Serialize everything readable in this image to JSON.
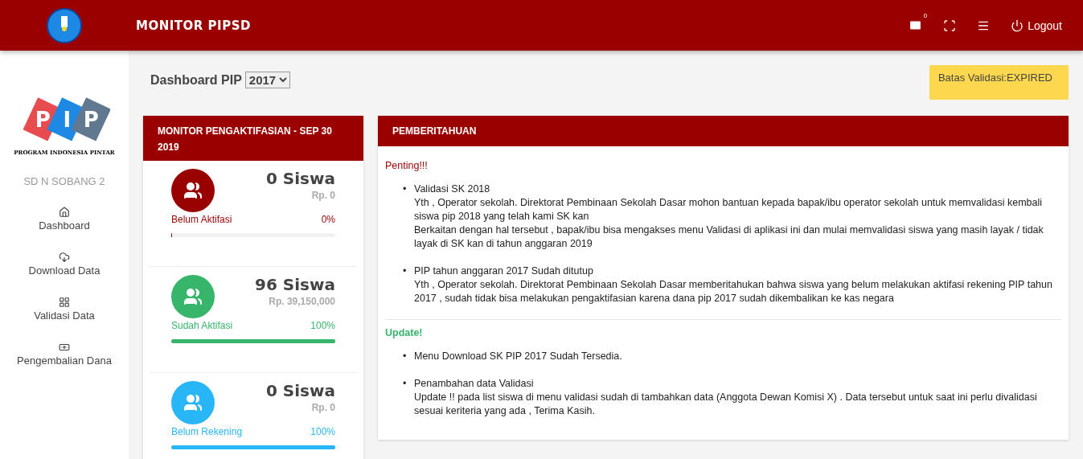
{
  "header": {
    "title": "MONITOR PIPSD",
    "mail_count": "0",
    "logout": "Logout"
  },
  "sidebar": {
    "logo_letters": [
      "P",
      "I",
      "P"
    ],
    "logo_caption": "PROGRAM INDONESIA PINTAR",
    "school": "SD N SOBANG 2",
    "items": [
      {
        "label": "Dashboard"
      },
      {
        "label": "Download Data"
      },
      {
        "label": "Validasi Data"
      },
      {
        "label": "Pengembalian Dana"
      }
    ]
  },
  "page": {
    "title": "Dashboard PIP",
    "year": "2017",
    "deadline": "Batas Validasi:EXPIRED"
  },
  "monitor": {
    "title": "MONITOR PENGAKTIFASIAN - SEP 30 2019",
    "stats": [
      {
        "count": "0 Siswa",
        "amount": "Rp. 0",
        "label": "Belum Aktifasi",
        "percent": "0%",
        "level": 0,
        "color": "#990000"
      },
      {
        "count": "96 Siswa",
        "amount": "Rp. 39,150,000",
        "label": "Sudah Aktifasi",
        "percent": "100%",
        "level": 1,
        "color": "#36b56b"
      },
      {
        "count": "0 Siswa",
        "amount": "Rp. 0",
        "label": "Belum Rekening",
        "percent": "100%",
        "level": 1,
        "color": "#29b6f6"
      }
    ]
  },
  "notices": {
    "title": "PEMBERITAHUAN",
    "sections": [
      {
        "heading": "Penting!!!",
        "color": "#990000",
        "items": [
          {
            "marker": "•",
            "title": "Validasi SK 2018",
            "lines": [
              "Yth , Operator sekolah. Direktorat Pembinaan Sekolah Dasar mohon bantuan kepada bapak/ibu operator sekolah untuk memvalidasi kembali siswa pip 2018 yang telah kami SK kan",
              "Berkaitan dengan hal tersebut , bapak/ibu bisa mengakses menu Validasi di aplikasi ini dan mulai memvalidasi siswa yang masih layak / tidak layak di SK kan di tahun anggaran 2019"
            ]
          },
          {
            "marker": "•",
            "title": "PIP tahun anggaran 2017 Sudah ditutup",
            "lines": [
              "Yth , Operator sekolah. Direktorat Pembinaan Sekolah Dasar memberitahukan bahwa siswa yang belum melakukan aktifasi rekening PIP tahun 2017 , sudah tidak bisa melakukan pengaktifasian karena dana pip 2017 sudah dikembalikan ke kas negara"
            ]
          }
        ]
      },
      {
        "heading": "Update!",
        "color": "#36b56b",
        "items": [
          {
            "marker": "•",
            "title": "Menu Download SK PIP 2017 Sudah Tersedia."
          },
          {
            "marker": "•",
            "title": "Penambahan data Validasi",
            "lines": [
              "Update !! pada list siswa di menu validasi sudah di tambahkan data (Anggota Dewan Komisi X) . Data tersebut untuk saat ini perlu divalidasi sesuai keriteria yang ada , Terima Kasih."
            ]
          }
        ]
      }
    ]
  }
}
